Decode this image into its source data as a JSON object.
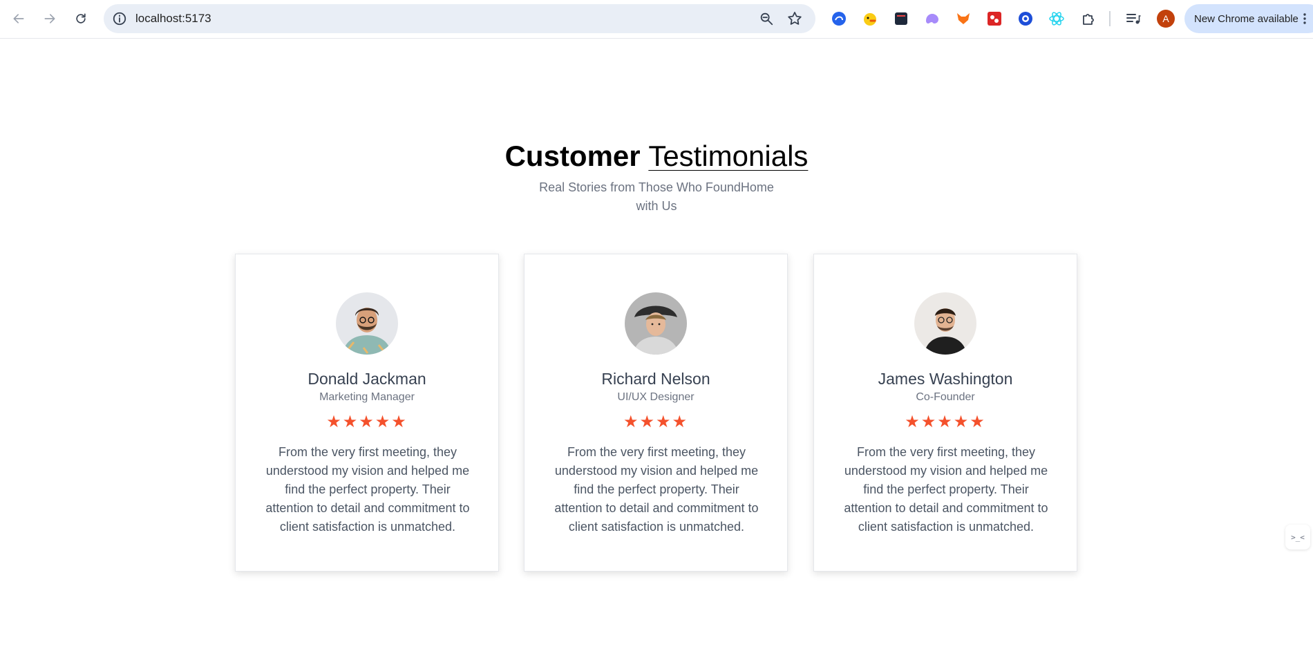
{
  "browser": {
    "url": "localhost:5173",
    "update_label": "New Chrome available",
    "profile_initial": "A",
    "extensions": [
      "edge-ext-icon",
      "duck-ext-icon",
      "dark-app-ext-icon",
      "ghost-ext-icon",
      "fox-ext-icon",
      "red-app-ext-icon",
      "target-ext-icon",
      "react-ext-icon",
      "puzzle-icon"
    ]
  },
  "section": {
    "title_bold": "Customer",
    "title_light": "Testimonials",
    "subtitle": "Real Stories from Those Who FoundHome with Us"
  },
  "testimonials": [
    {
      "name": "Donald Jackman",
      "role": "Marketing Manager",
      "rating": 5,
      "stars": "★★★★★",
      "quote": "From the very first meeting, they understood my vision and helped me find the perfect property. Their attention to detail and commitment to client satisfaction is unmatched."
    },
    {
      "name": "Richard Nelson",
      "role": "UI/UX Designer",
      "rating": 4,
      "stars": "★★★★",
      "quote": "From the very first meeting, they understood my vision and helped me find the perfect property. Their attention to detail and commitment to client satisfaction is unmatched."
    },
    {
      "name": "James Washington",
      "role": "Co-Founder",
      "rating": 5,
      "stars": "★★★★★",
      "quote": "From the very first meeting, they understood my vision and helped me find the perfect property. Their attention to detail and commitment to client satisfaction is unmatched."
    }
  ],
  "side_widget": {
    "label": ">_<"
  },
  "colors": {
    "star": "#f4512c",
    "heading": "#000000",
    "muted": "#6b7280"
  }
}
